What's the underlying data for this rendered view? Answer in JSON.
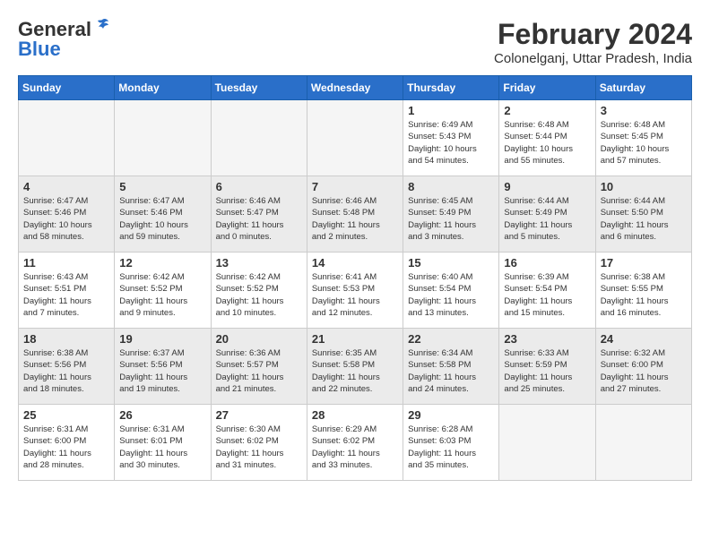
{
  "header": {
    "logo_general": "General",
    "logo_blue": "Blue",
    "month_title": "February 2024",
    "location": "Colonelganj, Uttar Pradesh, India"
  },
  "days_of_week": [
    "Sunday",
    "Monday",
    "Tuesday",
    "Wednesday",
    "Thursday",
    "Friday",
    "Saturday"
  ],
  "weeks": [
    [
      {
        "day": "",
        "info": "",
        "empty": true
      },
      {
        "day": "",
        "info": "",
        "empty": true
      },
      {
        "day": "",
        "info": "",
        "empty": true
      },
      {
        "day": "",
        "info": "",
        "empty": true
      },
      {
        "day": "1",
        "info": "Sunrise: 6:49 AM\nSunset: 5:43 PM\nDaylight: 10 hours\nand 54 minutes."
      },
      {
        "day": "2",
        "info": "Sunrise: 6:48 AM\nSunset: 5:44 PM\nDaylight: 10 hours\nand 55 minutes."
      },
      {
        "day": "3",
        "info": "Sunrise: 6:48 AM\nSunset: 5:45 PM\nDaylight: 10 hours\nand 57 minutes."
      }
    ],
    [
      {
        "day": "4",
        "info": "Sunrise: 6:47 AM\nSunset: 5:46 PM\nDaylight: 10 hours\nand 58 minutes."
      },
      {
        "day": "5",
        "info": "Sunrise: 6:47 AM\nSunset: 5:46 PM\nDaylight: 10 hours\nand 59 minutes."
      },
      {
        "day": "6",
        "info": "Sunrise: 6:46 AM\nSunset: 5:47 PM\nDaylight: 11 hours\nand 0 minutes."
      },
      {
        "day": "7",
        "info": "Sunrise: 6:46 AM\nSunset: 5:48 PM\nDaylight: 11 hours\nand 2 minutes."
      },
      {
        "day": "8",
        "info": "Sunrise: 6:45 AM\nSunset: 5:49 PM\nDaylight: 11 hours\nand 3 minutes."
      },
      {
        "day": "9",
        "info": "Sunrise: 6:44 AM\nSunset: 5:49 PM\nDaylight: 11 hours\nand 5 minutes."
      },
      {
        "day": "10",
        "info": "Sunrise: 6:44 AM\nSunset: 5:50 PM\nDaylight: 11 hours\nand 6 minutes."
      }
    ],
    [
      {
        "day": "11",
        "info": "Sunrise: 6:43 AM\nSunset: 5:51 PM\nDaylight: 11 hours\nand 7 minutes."
      },
      {
        "day": "12",
        "info": "Sunrise: 6:42 AM\nSunset: 5:52 PM\nDaylight: 11 hours\nand 9 minutes."
      },
      {
        "day": "13",
        "info": "Sunrise: 6:42 AM\nSunset: 5:52 PM\nDaylight: 11 hours\nand 10 minutes."
      },
      {
        "day": "14",
        "info": "Sunrise: 6:41 AM\nSunset: 5:53 PM\nDaylight: 11 hours\nand 12 minutes."
      },
      {
        "day": "15",
        "info": "Sunrise: 6:40 AM\nSunset: 5:54 PM\nDaylight: 11 hours\nand 13 minutes."
      },
      {
        "day": "16",
        "info": "Sunrise: 6:39 AM\nSunset: 5:54 PM\nDaylight: 11 hours\nand 15 minutes."
      },
      {
        "day": "17",
        "info": "Sunrise: 6:38 AM\nSunset: 5:55 PM\nDaylight: 11 hours\nand 16 minutes."
      }
    ],
    [
      {
        "day": "18",
        "info": "Sunrise: 6:38 AM\nSunset: 5:56 PM\nDaylight: 11 hours\nand 18 minutes."
      },
      {
        "day": "19",
        "info": "Sunrise: 6:37 AM\nSunset: 5:56 PM\nDaylight: 11 hours\nand 19 minutes."
      },
      {
        "day": "20",
        "info": "Sunrise: 6:36 AM\nSunset: 5:57 PM\nDaylight: 11 hours\nand 21 minutes."
      },
      {
        "day": "21",
        "info": "Sunrise: 6:35 AM\nSunset: 5:58 PM\nDaylight: 11 hours\nand 22 minutes."
      },
      {
        "day": "22",
        "info": "Sunrise: 6:34 AM\nSunset: 5:58 PM\nDaylight: 11 hours\nand 24 minutes."
      },
      {
        "day": "23",
        "info": "Sunrise: 6:33 AM\nSunset: 5:59 PM\nDaylight: 11 hours\nand 25 minutes."
      },
      {
        "day": "24",
        "info": "Sunrise: 6:32 AM\nSunset: 6:00 PM\nDaylight: 11 hours\nand 27 minutes."
      }
    ],
    [
      {
        "day": "25",
        "info": "Sunrise: 6:31 AM\nSunset: 6:00 PM\nDaylight: 11 hours\nand 28 minutes."
      },
      {
        "day": "26",
        "info": "Sunrise: 6:31 AM\nSunset: 6:01 PM\nDaylight: 11 hours\nand 30 minutes."
      },
      {
        "day": "27",
        "info": "Sunrise: 6:30 AM\nSunset: 6:02 PM\nDaylight: 11 hours\nand 31 minutes."
      },
      {
        "day": "28",
        "info": "Sunrise: 6:29 AM\nSunset: 6:02 PM\nDaylight: 11 hours\nand 33 minutes."
      },
      {
        "day": "29",
        "info": "Sunrise: 6:28 AM\nSunset: 6:03 PM\nDaylight: 11 hours\nand 35 minutes."
      },
      {
        "day": "",
        "info": "",
        "empty": true
      },
      {
        "day": "",
        "info": "",
        "empty": true
      }
    ]
  ]
}
